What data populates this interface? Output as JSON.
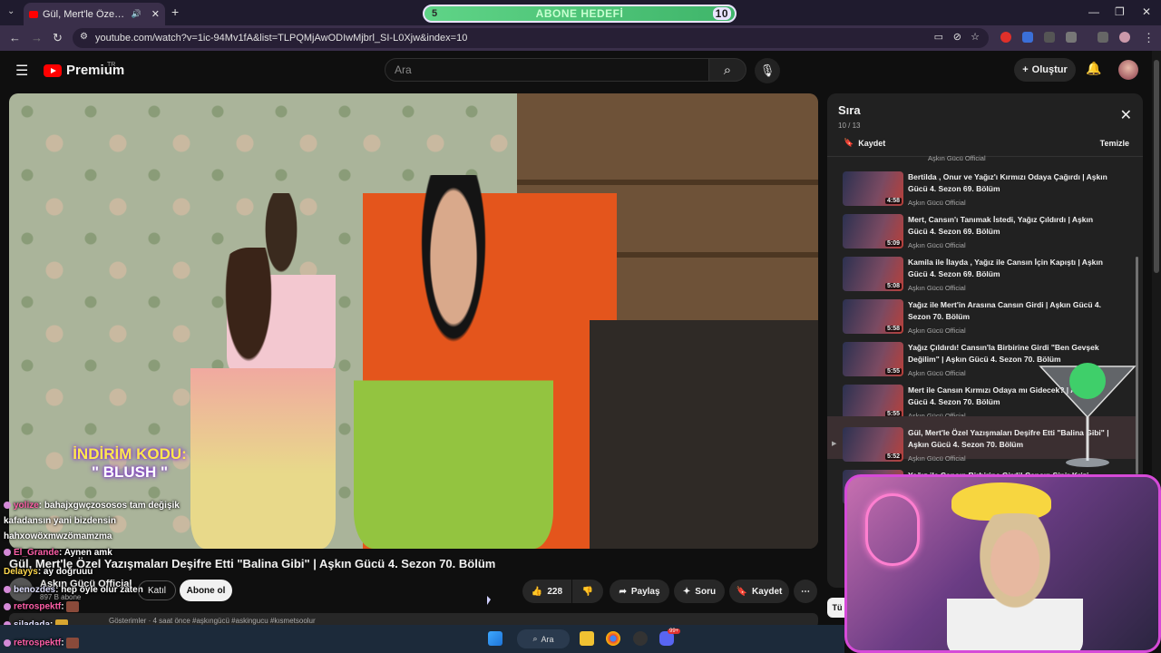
{
  "browser": {
    "tab_title": "Gül, Mert'le Özel Yazışmaları",
    "url": "youtube.com/watch?v=1ic-94Mv1fA&list=TLPQMjAwODIwMjbrl_SI-L0Xjw&index=10",
    "goal": {
      "left_num": "5",
      "label": "ABONE HEDEFİ",
      "right_num": "10"
    }
  },
  "header": {
    "logo_text": "Premium",
    "region": "TR",
    "search_placeholder": "Ara",
    "create_label": "Oluştur"
  },
  "video": {
    "title": "Gül, Mert'le Özel Yazışmaları Deşifre Etti \"Balina Gibi\" | Aşkın Gücü 4. Sezon 70. Bölüm",
    "promo_line1": "İNDİRİM KODU:",
    "promo_line2": "\" BLUSH \"",
    "channel": "Aşkın Gücü Official",
    "subs": "897 B abone",
    "join": "Katıl",
    "subscribe": "Abone ol",
    "likes": "228",
    "share": "Paylaş",
    "ask": "Soru",
    "save": "Kaydet",
    "desc": "Gösterimler · 4 saat önce  #aşkıngücü #askingucu #kısmetsoolur"
  },
  "chat": [
    {
      "user": "yolize",
      "msg": ": bahajxgwçzososos tam değişik"
    },
    {
      "user": "",
      "msg": "kafadansın yani bizdensin"
    },
    {
      "user": "",
      "msg": "hahxowöxmwzömamzma"
    },
    {
      "user": "El_Grande",
      "msg": ": Aynen amk"
    },
    {
      "user": "Delayys",
      "msg": ": ay doğruuu"
    },
    {
      "user": "benozdes",
      "msg": ": hep öyle olur zaten"
    },
    {
      "user": "retrospektf",
      "msg": ":"
    },
    {
      "user": "siladada",
      "msg": ":"
    },
    {
      "user": "retrospektf",
      "msg": ":"
    }
  ],
  "queue": {
    "title": "Sıra",
    "count": "10 / 13",
    "save": "Kaydet",
    "clear": "Temizle",
    "top_channel": "Aşkın Gücü Official",
    "items": [
      {
        "title": "Bertilda , Onur ve Yağız'ı Kırmızı Odaya Çağırdı | Aşkın Gücü 4. Sezon 69. Bölüm",
        "channel": "Aşkın Gücü Official",
        "duration": "4:58",
        "active": false
      },
      {
        "title": "Mert, Cansın'ı Tanımak İstedi, Yağız Çıldırdı | Aşkın Gücü 4. Sezon 69. Bölüm",
        "channel": "Aşkın Gücü Official",
        "duration": "5:09",
        "active": false
      },
      {
        "title": "Kamila ile İlayda , Yağız ile Cansın İçin Kapıştı | Aşkın Gücü 4. Sezon 69. Bölüm",
        "channel": "Aşkın Gücü Official",
        "duration": "5:08",
        "active": false
      },
      {
        "title": "Yağız ile Mert'in Arasına Cansın Girdi | Aşkın Gücü 4. Sezon 70. Bölüm",
        "channel": "Aşkın Gücü Official",
        "duration": "5:58",
        "active": false
      },
      {
        "title": "Yağız Çıldırdı! Cansın'la Birbirine Girdi \"Ben Gevşek Değilim\" | Aşkın Gücü 4. Sezon 70. Bölüm",
        "channel": "Aşkın Gücü Official",
        "duration": "5:55",
        "active": false
      },
      {
        "title": "Mert ile Cansın Kırmızı Odaya mı Gidecek? | Aşkın Gücü 4. Sezon 70. Bölüm",
        "channel": "Aşkın Gücü Official",
        "duration": "5:55",
        "active": false
      },
      {
        "title": "Gül, Mert'le Özel Yazışmaları Deşifre Etti \"Balina Gibi\" | Aşkın Gücü 4. Sezon 70. Bölüm",
        "channel": "Aşkın Gücü Official",
        "duration": "5:52",
        "active": true
      },
      {
        "title": "Yağız ile Cansın Birbirine Girdi! Cansın Sinir Krizi",
        "channel": "",
        "duration": "",
        "active": false
      }
    ]
  },
  "side_chip": "Tü",
  "taskbar": {
    "search": "Ara",
    "badge": "99+"
  }
}
